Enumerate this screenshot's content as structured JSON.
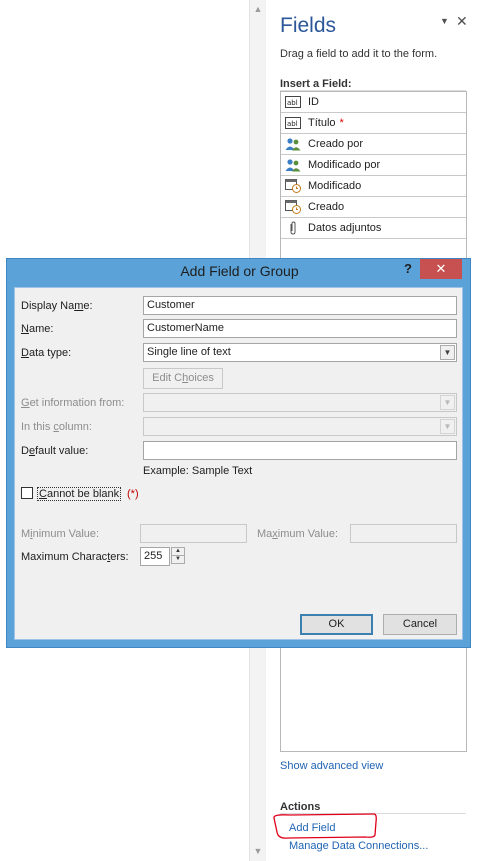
{
  "pane": {
    "title": "Fields",
    "description": "Drag a field to add it to the form.",
    "insert_label": "Insert a Field:",
    "fields": [
      {
        "label": "ID",
        "icon": "text-field-icon",
        "required": ""
      },
      {
        "label": "Título",
        "icon": "text-field-icon",
        "required": "*"
      },
      {
        "label": "Creado por",
        "icon": "people-icon",
        "required": ""
      },
      {
        "label": "Modificado por",
        "icon": "people-icon",
        "required": ""
      },
      {
        "label": "Modificado",
        "icon": "calendar-clock-icon",
        "required": ""
      },
      {
        "label": "Creado",
        "icon": "calendar-clock-icon",
        "required": ""
      },
      {
        "label": "Datos adjuntos",
        "icon": "paperclip-icon",
        "required": ""
      }
    ],
    "advanced_link": "Show advanced view",
    "actions_label": "Actions",
    "add_field_link": "Add Field",
    "manage_link": "Manage Data Connections..."
  },
  "dialog": {
    "title": "Add Field or Group",
    "help": "?",
    "close": "✕",
    "display_name": {
      "label_pre": "Display Na",
      "label_u": "m",
      "label_post": "e:",
      "value": "Customer"
    },
    "name": {
      "label_u": "N",
      "label_post": "ame:",
      "value": "CustomerName"
    },
    "data_type": {
      "label_u": "D",
      "label_post": "ata type:",
      "value": "Single line of text"
    },
    "edit_choices": {
      "pre": "Edit C",
      "u": "h",
      "post": "oices"
    },
    "get_info": {
      "label_u": "G",
      "label_post": "et information from:",
      "value": ""
    },
    "in_column": {
      "label_pre": "In this ",
      "label_u": "c",
      "label_post": "olumn:",
      "value": ""
    },
    "default_value": {
      "label_pre": "D",
      "label_u": "e",
      "label_post": "fault value:",
      "value": ""
    },
    "example": "Example: Sample Text",
    "cannot_be_blank": {
      "u": "C",
      "post": "annot be blank",
      "marker": "(*)"
    },
    "min_value": {
      "label_pre": "M",
      "label_u": "i",
      "label_post": "nimum Value:",
      "value": ""
    },
    "max_value": {
      "label_pre": "Ma",
      "label_u": "x",
      "label_post": "imum Value:",
      "value": ""
    },
    "max_chars": {
      "label_pre": "Maximum Charac",
      "label_u": "t",
      "label_post": "ers:",
      "value": "255"
    },
    "ok": "OK",
    "cancel": "Cancel"
  },
  "colors": {
    "pane_title": "#2b579a",
    "link": "#1f64b4",
    "dialog_frame": "#5aa2d8",
    "close_button": "#c75050",
    "annotation": "#e0001a",
    "required_star": "#e00000"
  }
}
